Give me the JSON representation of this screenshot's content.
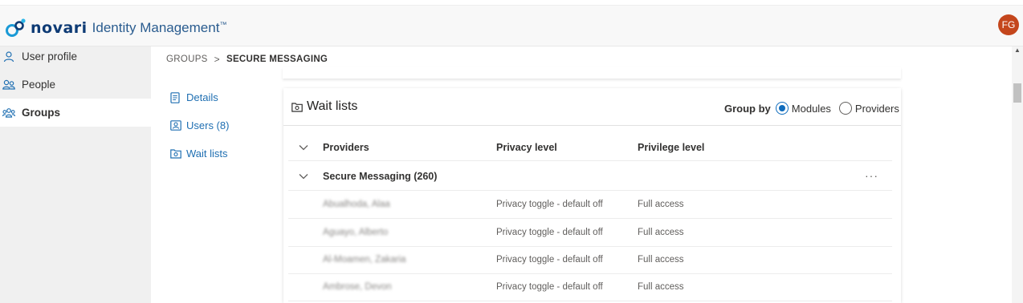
{
  "header": {
    "brand": "novari",
    "product": "Identity Management",
    "trademark": "™",
    "avatar_initials": "FG",
    "avatar_color": "#c4461c"
  },
  "sidebar": {
    "items": [
      {
        "label": "User profile",
        "icon": "person-icon",
        "active": false
      },
      {
        "label": "People",
        "icon": "people-icon",
        "active": false
      },
      {
        "label": "Groups",
        "icon": "groups-icon",
        "active": true
      }
    ]
  },
  "breadcrumb": {
    "root": "GROUPS",
    "separator": ">",
    "current": "SECURE MESSAGING"
  },
  "subnav": {
    "items": [
      {
        "label": "Details",
        "icon": "document-icon"
      },
      {
        "label": "Users (8)",
        "icon": "contact-card-icon"
      },
      {
        "label": "Wait lists",
        "icon": "folder-camera-icon"
      }
    ]
  },
  "waitlists": {
    "title": "Wait lists",
    "group_by_label": "Group by",
    "options": [
      {
        "label": "Modules",
        "selected": true
      },
      {
        "label": "Providers",
        "selected": false
      }
    ],
    "columns": {
      "providers": "Providers",
      "privacy": "Privacy level",
      "privilege": "Privilege level"
    },
    "group": {
      "name": "Secure Messaging (260)",
      "more": "···"
    },
    "rows": [
      {
        "name": "Abualhoda, Alaa",
        "privacy": "Privacy toggle - default off",
        "privilege": "Full access"
      },
      {
        "name": "Aguayo, Alberto",
        "privacy": "Privacy toggle - default off",
        "privilege": "Full access"
      },
      {
        "name": "Al-Moamen, Zakaria",
        "privacy": "Privacy toggle - default off",
        "privilege": "Full access"
      },
      {
        "name": "Ambrose, Devon",
        "privacy": "Privacy toggle - default off",
        "privilege": "Full access"
      }
    ]
  },
  "colors": {
    "accent": "#0f6cbd",
    "link": "#1f6fb2",
    "brand": "#0e3b75"
  }
}
